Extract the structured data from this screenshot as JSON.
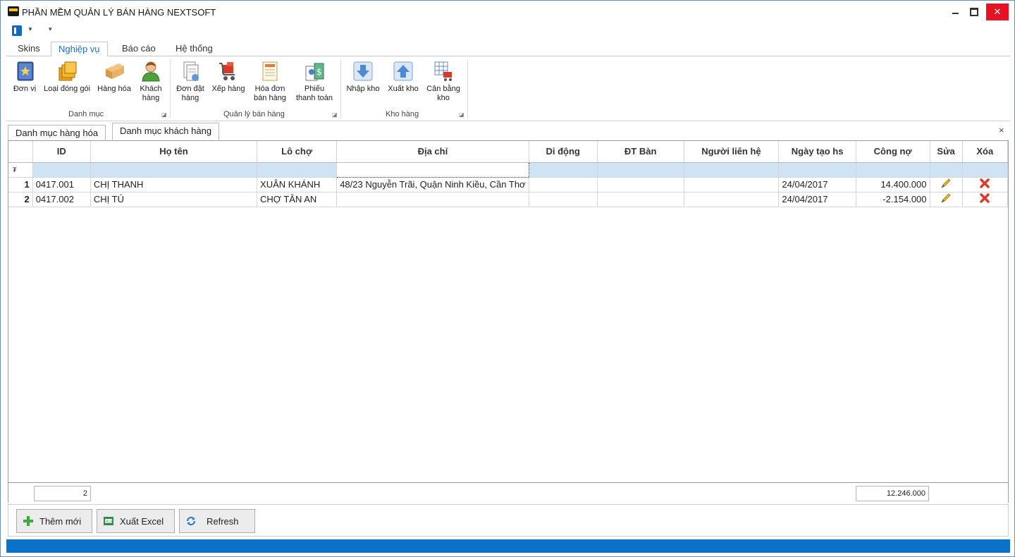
{
  "window": {
    "title": "PHẦN MỀM QUẢN LÝ BÁN HÀNG NEXTSOFT",
    "close_glyph": "✕"
  },
  "ribbon": {
    "tabs": [
      "Skins",
      "Nghiệp vụ",
      "Báo cáo",
      "Hệ thống"
    ],
    "active_tab": "Nghiệp vụ",
    "groups": [
      {
        "label": "Danh mục",
        "buttons": [
          {
            "label": "Đơn vị",
            "icon": "unit-book-icon"
          },
          {
            "label": "Loại đóng gói",
            "icon": "package-type-icon"
          },
          {
            "label": "Hàng hóa",
            "icon": "goods-boxes-icon"
          },
          {
            "label": "Khách hàng",
            "icon": "customer-icon"
          }
        ]
      },
      {
        "label": "Quản lý bán hàng",
        "buttons": [
          {
            "label": "Đơn đặt hàng",
            "icon": "order-document-icon"
          },
          {
            "label": "Xếp hàng",
            "icon": "cart-icon"
          },
          {
            "label": "Hóa đơn bán hàng",
            "icon": "invoice-icon"
          },
          {
            "label": "Phiếu thanh toán",
            "icon": "payment-slip-icon"
          }
        ]
      },
      {
        "label": "Kho hàng",
        "buttons": [
          {
            "label": "Nhập kho",
            "icon": "import-arrow-icon"
          },
          {
            "label": "Xuất kho",
            "icon": "export-arrow-icon"
          },
          {
            "label": "Cân bằng kho",
            "icon": "stock-balance-icon"
          }
        ]
      }
    ]
  },
  "doc_tabs": [
    {
      "label": "Danh mục hàng hóa",
      "active": false
    },
    {
      "label": "Danh mục khách hàng",
      "active": true
    }
  ],
  "doc_close_glyph": "×",
  "grid": {
    "columns": [
      "ID",
      "Họ tên",
      "Lô chợ",
      "Địa chỉ",
      "Di động",
      "ĐT Bàn",
      "Người liên hệ",
      "Ngày tạo hs",
      "Công nợ",
      "Sửa",
      "Xóa"
    ],
    "filter_glyph": "₮",
    "rows": [
      {
        "index": "1",
        "id": "0417.001",
        "name": "CHỊ THANH",
        "market": "XUÂN KHÁNH",
        "address": "48/23 Nguyễn Trãi, Quận Ninh Kiều, Cần Thơ",
        "mobile": "",
        "phone": "",
        "contact": "",
        "created": "24/04/2017",
        "debt": "14.400.000"
      },
      {
        "index": "2",
        "id": "0417.002",
        "name": "CHỊ TÚ",
        "market": "CHỢ TÂN AN",
        "address": "",
        "mobile": "",
        "phone": "",
        "contact": "",
        "created": "24/04/2017",
        "debt": "-2.154.000"
      }
    ],
    "footer": {
      "count": "2",
      "total_debt": "12.246.000"
    }
  },
  "actions": {
    "add": "Thêm mới",
    "export": "Xuất Excel",
    "refresh": "Refresh"
  },
  "colors": {
    "accent": "#0b72c9",
    "filter_row": "#cfe3f5",
    "delete_red": "#e03a2a",
    "edit_yellow": "#e8b81e"
  }
}
